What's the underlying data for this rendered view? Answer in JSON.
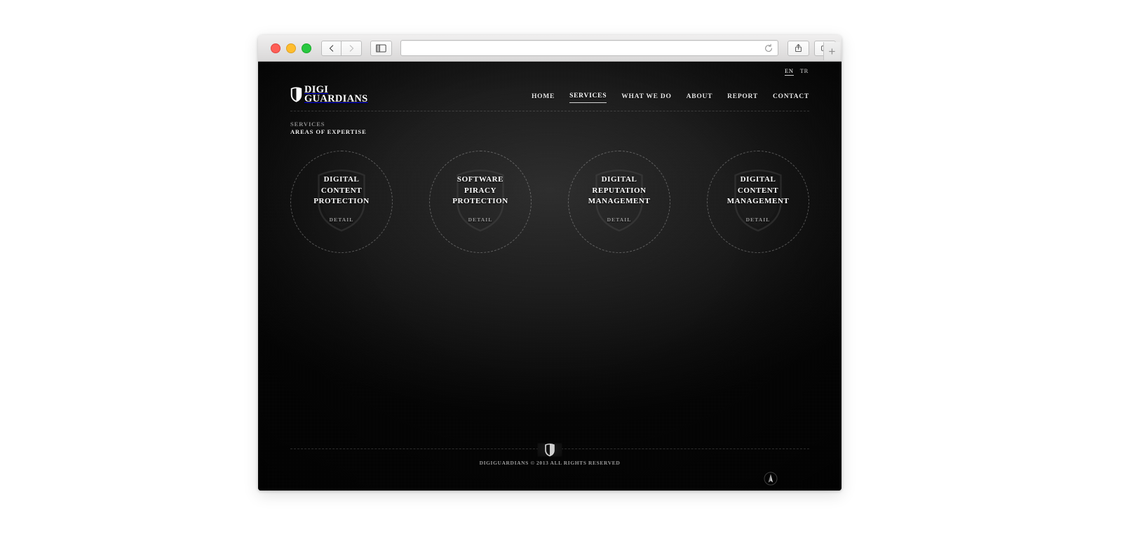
{
  "browser": {
    "traffic_lights": [
      "close",
      "minimize",
      "maximize"
    ],
    "back_label": "‹",
    "forward_label": "›",
    "sidebar_label": "sidebar",
    "url_value": "",
    "url_placeholder": "",
    "reload_label": "Reload",
    "share_label": "Share",
    "tabs_label": "Show tabs",
    "new_tab_label": "+"
  },
  "site": {
    "languages": [
      {
        "code": "EN",
        "active": true
      },
      {
        "code": "TR",
        "active": false
      }
    ],
    "logo": {
      "line1": "DIGI",
      "line2": "GUARDIANS"
    },
    "nav": [
      {
        "label": "HOME",
        "active": false
      },
      {
        "label": "SERVICES",
        "active": true
      },
      {
        "label": "WHAT WE DO",
        "active": false
      },
      {
        "label": "ABOUT",
        "active": false
      },
      {
        "label": "REPORT",
        "active": false
      },
      {
        "label": "CONTACT",
        "active": false
      }
    ],
    "section": {
      "kicker": "SERVICES",
      "title": "AREAS OF EXPERTISE"
    },
    "services": [
      {
        "title_lines": [
          "DIGITAL",
          "CONTENT",
          "PROTECTION"
        ],
        "detail_label": "DETAIL"
      },
      {
        "title_lines": [
          "SOFTWARE",
          "PIRACY",
          "PROTECTION"
        ],
        "detail_label": "DETAIL"
      },
      {
        "title_lines": [
          "DIGITAL",
          "REPUTATION",
          "MANAGEMENT"
        ],
        "detail_label": "DETAIL"
      },
      {
        "title_lines": [
          "DIGITAL",
          "CONTENT",
          "MANAGEMENT"
        ],
        "detail_label": "DETAIL"
      }
    ],
    "footer": {
      "copyright": "DIGIGUARDIANS © 2013 ALL RIGHTS RESERVED"
    },
    "colors": {
      "background": "#0d0d0d",
      "text_primary": "#ffffff",
      "text_muted": "#8c8c8c",
      "rule": "#2b2b2b"
    }
  }
}
